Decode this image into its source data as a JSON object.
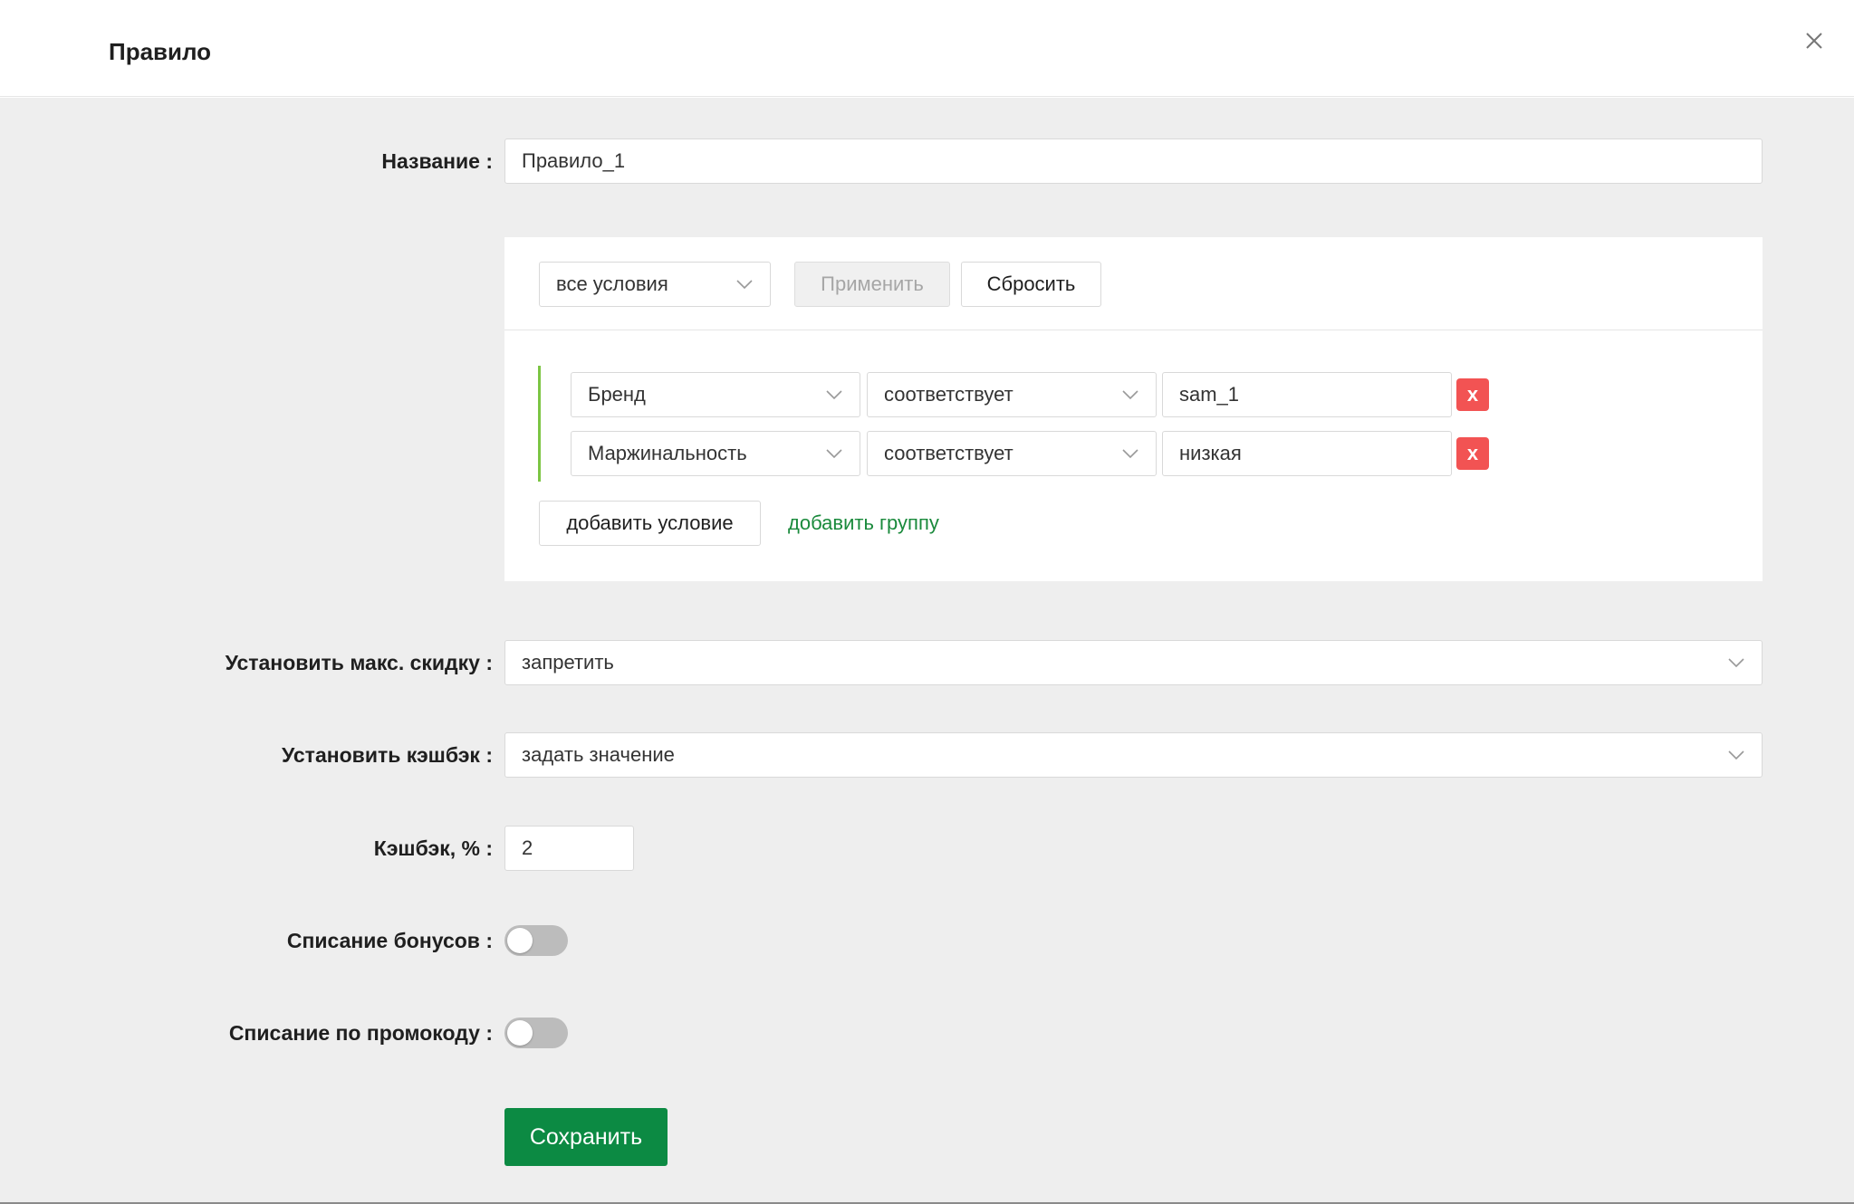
{
  "modal": {
    "title": "Правило",
    "close_icon": "close-icon"
  },
  "form": {
    "name_label": "Название :",
    "name_value": "Правило_1",
    "filter": {
      "mode_value": "все условия",
      "apply_label": "Применить",
      "reset_label": "Сбросить",
      "conditions": [
        {
          "field": "Бренд",
          "operator": "соответствует",
          "value": "sam_1",
          "remove_label": "x"
        },
        {
          "field": "Маржинальность",
          "operator": "соответствует",
          "value": "низкая",
          "remove_label": "x"
        }
      ],
      "add_condition_label": "добавить условие",
      "add_group_label": "добавить группу"
    },
    "max_discount_label": "Установить макс. скидку :",
    "max_discount_value": "запретить",
    "cashback_mode_label": "Установить кэшбэк :",
    "cashback_mode_value": "задать значение",
    "cashback_percent_label": "Кэшбэк, % :",
    "cashback_percent_value": "2",
    "bonus_writeoff_label": "Списание бонусов :",
    "bonus_writeoff_enabled": false,
    "promo_writeoff_label": "Списание по промокоду :",
    "promo_writeoff_enabled": false,
    "save_label": "Сохранить"
  },
  "colors": {
    "accent_green": "#0c8a43",
    "link_green": "#1a8a3c",
    "group_bar": "#7cc543",
    "remove_red": "#f25353",
    "body_bg": "#eeeeee"
  }
}
